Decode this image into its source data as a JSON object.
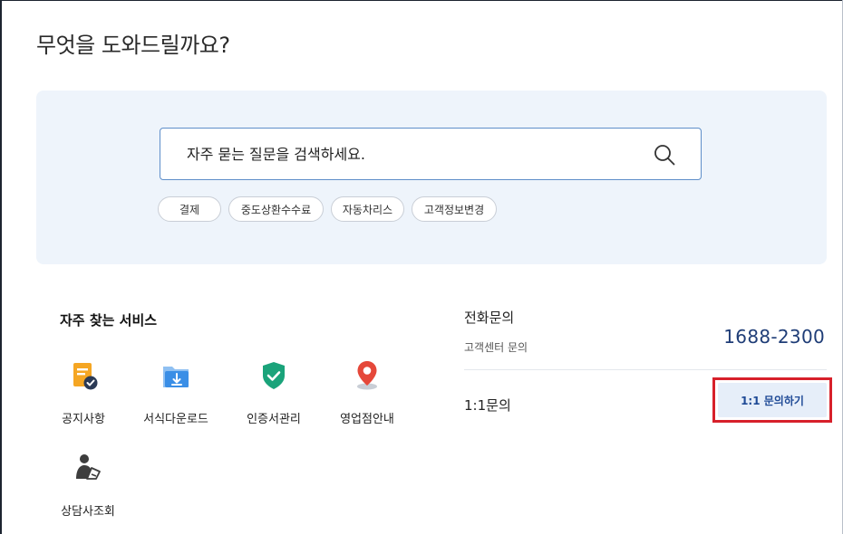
{
  "page": {
    "title": "무엇을 도와드릴까요?"
  },
  "search": {
    "placeholder": "자주 묻는 질문을 검색하세요.",
    "value": "",
    "icon": "search-icon"
  },
  "tags": [
    {
      "label": "결제"
    },
    {
      "label": "중도상환수수료"
    },
    {
      "label": "자동차리스"
    },
    {
      "label": "고객정보변경"
    }
  ],
  "services": {
    "title": "자주 찾는 서비스",
    "items": [
      {
        "label": "공지사항",
        "icon": "notice-icon"
      },
      {
        "label": "서식다운로드",
        "icon": "download-folder-icon"
      },
      {
        "label": "인증서관리",
        "icon": "certificate-shield-icon"
      },
      {
        "label": "영업점안내",
        "icon": "location-pin-icon"
      },
      {
        "label": "상담사조회",
        "icon": "counselor-icon"
      }
    ]
  },
  "contact": {
    "phone_title": "전화문의",
    "phone_sub": "고객센터 문의",
    "phone_number": "1688-2300",
    "inquiry_label": "1:1문의",
    "inquiry_button": "1:1 문의하기"
  },
  "colors": {
    "accent": "#1f3d77",
    "panel_bg": "#eef4fb",
    "highlight": "#d7202a",
    "notice_icon": "#f5a623",
    "download_icon": "#3a8ee6",
    "shield_icon": "#1aa37a",
    "pin_icon": "#e5483a"
  }
}
